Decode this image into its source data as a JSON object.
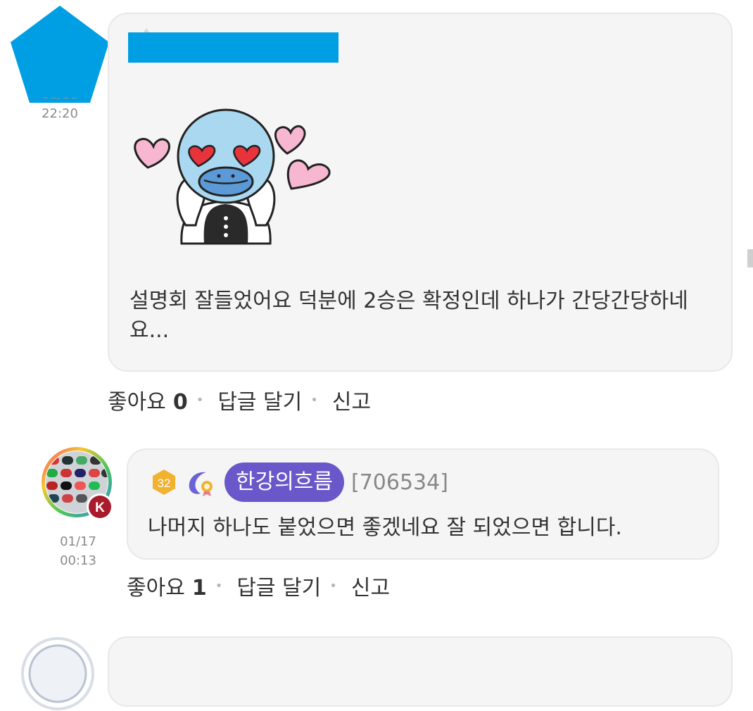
{
  "comments": [
    {
      "timestamp_date": "01/16",
      "timestamp_time": "22:20",
      "sticker": "blue-duck-heart-eyes-sticker",
      "text": "설명회 잘들었어요 덕분에 2승은 확정인데 하나가 간당간당하네요...",
      "like_label": "좋아요",
      "like_count": "0",
      "reply_label": "답글 달기",
      "report_label": "신고"
    },
    {
      "timestamp_date": "01/17",
      "timestamp_time": "00:13",
      "level": "32",
      "badge_letter": "K",
      "nickname": "한강의흐름",
      "user_id": "[706534]",
      "text": "나머지 하나도 붙었으면 좋겠네요 잘 되었으면 합니다.",
      "like_label": "좋아요",
      "like_count": "1",
      "reply_label": "답글 달기",
      "report_label": "신고"
    }
  ],
  "colors": {
    "redaction_blue": "#009fe3",
    "nickname_pill": "#6a57c9",
    "bubble_bg": "#f5f5f6",
    "level_badge": "#f2b230"
  }
}
